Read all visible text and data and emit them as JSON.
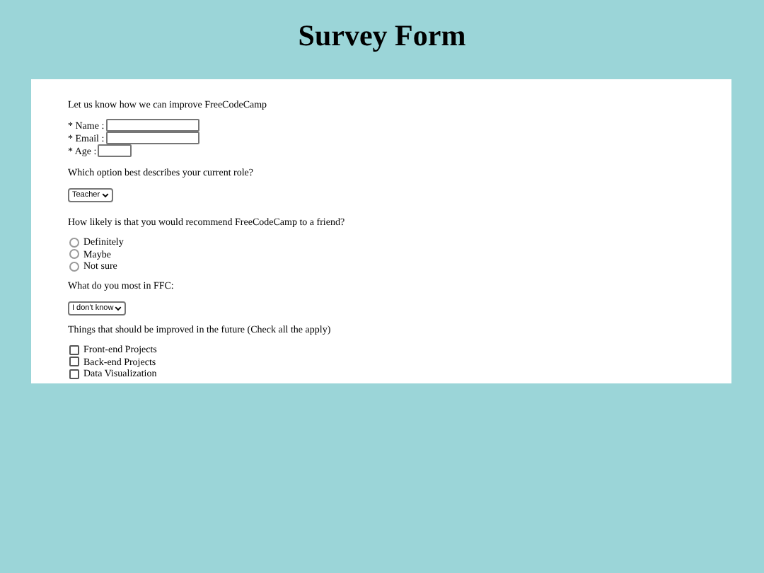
{
  "title": "Survey Form",
  "intro": "Let us know how we can improve FreeCodeCamp",
  "fields": [
    {
      "label": "* Name :"
    },
    {
      "label": "* Email :"
    },
    {
      "label": "* Age :"
    }
  ],
  "role_question": "Which option best describes your current role?",
  "role_select": {
    "value": "Teacher"
  },
  "recommend_question": "How likely is that you would recommend FreeCodeCamp to a friend?",
  "recommend_options": [
    {
      "label": "Definitely",
      "selected": false
    },
    {
      "label": "Maybe",
      "selected": false
    },
    {
      "label": "Not sure",
      "selected": false
    }
  ],
  "ffc_question": "What do you most in FFC:",
  "ffc_select": {
    "value": "I don't know"
  },
  "improve_question": "Things that should be improved in the future (Check all the apply)",
  "improve_options": [
    {
      "label": "Front-end Projects",
      "checked": false
    },
    {
      "label": "Back-end Projects",
      "checked": false
    },
    {
      "label": "Data Visualization",
      "checked": false
    }
  ]
}
